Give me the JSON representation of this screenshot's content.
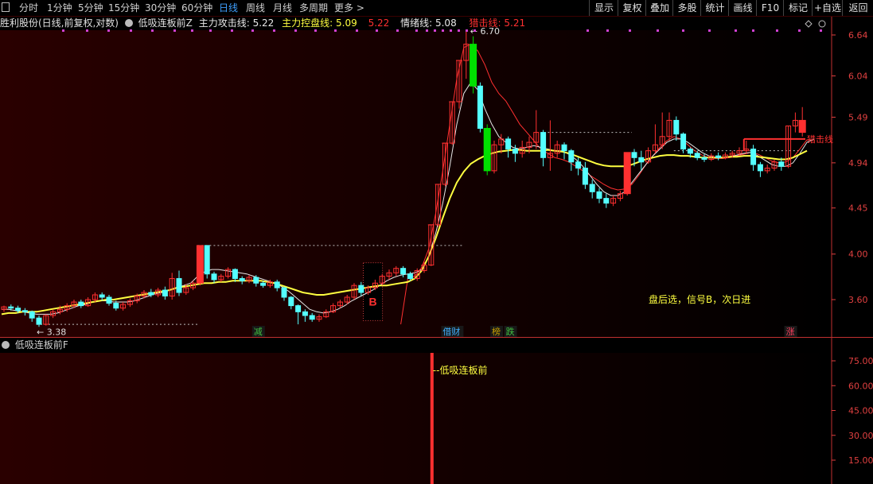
{
  "toolbar": {
    "periods": [
      "分时",
      "1分钟",
      "5分钟",
      "15分钟",
      "30分钟",
      "60分钟",
      "日线",
      "周线",
      "月线",
      "多周期",
      "更多 >"
    ],
    "active_period": "日线",
    "buttons": [
      "显示",
      "复权",
      "叠加",
      "多股",
      "统计",
      "画线",
      "F10",
      "标记",
      "+自选",
      "返回"
    ]
  },
  "info": {
    "stock": "胜利股份(日线,前复权,对数)",
    "indicator": "低吸连板前Z",
    "attack_label": "主力攻击线:",
    "attack_value": "5.22",
    "control_label": "主力控盘线:",
    "control_value": "5.09",
    "extra_value": "5.22",
    "emotion_label": "情绪线:",
    "emotion_value": "5.08",
    "strike_label": "猎击线:",
    "strike_value": "5.21"
  },
  "sub_panel": {
    "title": "低吸连板前F",
    "signal_label": "--低吸连板前"
  },
  "colors": {
    "up": "#ff3030",
    "down": "#54ffff",
    "ma_yellow": "#ffff40",
    "ma_white": "#e8e8e8",
    "ma_red": "#ff3030",
    "signal_green": "#00e000",
    "axis": "#e04040"
  },
  "chart_data": [
    {
      "type": "candlestick",
      "title": "",
      "scale": "log",
      "y_ticks": [
        3.6,
        4.0,
        4.45,
        4.94,
        5.49,
        6.04,
        6.64
      ],
      "high_label": "6.70",
      "low_label": "3.38",
      "annotation": "盘后选，信号B，次日进",
      "signal_letter": "B",
      "event_tags": [
        "减",
        "借财",
        "榜",
        "跌",
        "涨"
      ],
      "strike_marker": "猎击线",
      "series": [
        {
          "name": "主力攻击线",
          "color": "#e8e8e8"
        },
        {
          "name": "主力控盘线",
          "color": "#ffff40"
        },
        {
          "name": "猎击线",
          "color": "#ff3030"
        }
      ],
      "candles": [
        [
          3.52,
          3.54,
          3.5,
          3.55
        ],
        [
          3.54,
          3.53,
          3.51,
          3.56
        ],
        [
          3.53,
          3.51,
          3.49,
          3.55
        ],
        [
          3.51,
          3.5,
          3.47,
          3.53
        ],
        [
          3.5,
          3.45,
          3.42,
          3.51
        ],
        [
          3.45,
          3.4,
          3.38,
          3.47
        ],
        [
          3.4,
          3.47,
          3.39,
          3.48
        ],
        [
          3.47,
          3.5,
          3.45,
          3.52
        ],
        [
          3.5,
          3.52,
          3.48,
          3.55
        ],
        [
          3.52,
          3.55,
          3.5,
          3.57
        ],
        [
          3.55,
          3.58,
          3.53,
          3.6
        ],
        [
          3.58,
          3.55,
          3.53,
          3.6
        ],
        [
          3.55,
          3.6,
          3.54,
          3.62
        ],
        [
          3.6,
          3.64,
          3.58,
          3.66
        ],
        [
          3.64,
          3.62,
          3.59,
          3.66
        ],
        [
          3.62,
          3.57,
          3.55,
          3.64
        ],
        [
          3.57,
          3.53,
          3.51,
          3.59
        ],
        [
          3.53,
          3.56,
          3.51,
          3.58
        ],
        [
          3.56,
          3.59,
          3.54,
          3.61
        ],
        [
          3.59,
          3.63,
          3.57,
          3.65
        ],
        [
          3.63,
          3.66,
          3.61,
          3.68
        ],
        [
          3.66,
          3.64,
          3.62,
          3.69
        ],
        [
          3.64,
          3.68,
          3.62,
          3.7
        ],
        [
          3.68,
          3.63,
          3.6,
          3.71
        ],
        [
          3.63,
          3.78,
          3.6,
          3.83
        ],
        [
          3.78,
          3.66,
          3.63,
          3.85
        ],
        [
          3.66,
          3.7,
          3.64,
          3.73
        ],
        [
          3.7,
          3.74,
          3.68,
          3.76
        ],
        [
          3.74,
          4.08,
          3.72,
          4.08
        ],
        [
          4.08,
          3.82,
          3.78,
          4.08
        ],
        [
          3.82,
          3.77,
          3.74,
          3.84
        ],
        [
          3.77,
          3.8,
          3.75,
          3.82
        ],
        [
          3.8,
          3.86,
          3.78,
          3.88
        ],
        [
          3.86,
          3.78,
          3.75,
          3.87
        ],
        [
          3.78,
          3.76,
          3.73,
          3.8
        ],
        [
          3.76,
          3.79,
          3.74,
          3.81
        ],
        [
          3.79,
          3.74,
          3.71,
          3.81
        ],
        [
          3.74,
          3.72,
          3.7,
          3.76
        ],
        [
          3.72,
          3.75,
          3.7,
          3.77
        ],
        [
          3.75,
          3.7,
          3.67,
          3.77
        ],
        [
          3.7,
          3.62,
          3.59,
          3.71
        ],
        [
          3.62,
          3.55,
          3.52,
          3.63
        ],
        [
          3.55,
          3.5,
          3.4,
          3.56
        ],
        [
          3.5,
          3.47,
          3.42,
          3.52
        ],
        [
          3.47,
          3.44,
          3.42,
          3.49
        ],
        [
          3.44,
          3.46,
          3.42,
          3.48
        ],
        [
          3.46,
          3.5,
          3.45,
          3.52
        ],
        [
          3.5,
          3.55,
          3.49,
          3.57
        ],
        [
          3.55,
          3.58,
          3.53,
          3.6
        ],
        [
          3.58,
          3.62,
          3.56,
          3.64
        ],
        [
          3.62,
          3.72,
          3.6,
          3.74
        ],
        [
          3.72,
          3.66,
          3.63,
          3.75
        ],
        [
          3.66,
          3.7,
          3.64,
          3.72
        ],
        [
          3.7,
          3.74,
          3.68,
          3.77
        ],
        [
          3.74,
          3.8,
          3.72,
          3.82
        ],
        [
          3.8,
          3.83,
          3.77,
          3.86
        ],
        [
          3.83,
          3.87,
          3.8,
          3.89
        ],
        [
          3.87,
          3.82,
          3.79,
          3.89
        ],
        [
          3.82,
          3.78,
          3.76,
          3.84
        ],
        [
          3.78,
          3.85,
          3.76,
          3.87
        ],
        [
          3.85,
          3.9,
          3.83,
          3.93
        ],
        [
          3.9,
          4.28,
          3.89,
          4.28
        ],
        [
          4.28,
          4.7,
          4.26,
          4.7
        ],
        [
          4.7,
          5.17,
          4.68,
          5.17
        ],
        [
          5.17,
          5.69,
          5.15,
          5.69
        ],
        [
          5.69,
          6.26,
          5.6,
          6.26
        ],
        [
          6.26,
          6.5,
          6.0,
          6.7
        ],
        [
          6.5,
          5.9,
          5.8,
          6.62
        ],
        [
          5.9,
          5.35,
          5.3,
          5.95
        ],
        [
          5.35,
          4.85,
          4.8,
          5.4
        ],
        [
          4.85,
          5.15,
          4.82,
          5.2
        ],
        [
          5.15,
          5.22,
          5.05,
          5.28
        ],
        [
          5.22,
          5.1,
          5.0,
          5.25
        ],
        [
          5.1,
          5.05,
          4.95,
          5.15
        ],
        [
          5.05,
          5.12,
          5.0,
          5.2
        ],
        [
          5.12,
          5.18,
          5.05,
          5.25
        ],
        [
          5.18,
          5.3,
          5.1,
          5.58
        ],
        [
          5.3,
          5.0,
          4.9,
          5.33
        ],
        [
          5.0,
          5.05,
          4.85,
          5.45
        ],
        [
          5.05,
          5.15,
          5.0,
          5.2
        ],
        [
          5.15,
          5.08,
          4.98,
          5.18
        ],
        [
          5.08,
          4.95,
          4.85,
          5.1
        ],
        [
          4.95,
          4.88,
          4.8,
          5.0
        ],
        [
          4.88,
          4.7,
          4.65,
          4.95
        ],
        [
          4.7,
          4.62,
          4.55,
          4.75
        ],
        [
          4.62,
          4.55,
          4.5,
          4.66
        ],
        [
          4.55,
          4.5,
          4.45,
          4.6
        ],
        [
          4.5,
          4.55,
          4.47,
          4.58
        ],
        [
          4.55,
          4.6,
          4.52,
          4.63
        ],
        [
          4.6,
          5.06,
          4.58,
          5.06
        ],
        [
          5.06,
          5.0,
          4.9,
          5.1
        ],
        [
          5.0,
          4.95,
          4.85,
          5.08
        ],
        [
          4.95,
          5.08,
          4.93,
          5.12
        ],
        [
          5.08,
          5.15,
          5.05,
          5.4
        ],
        [
          5.15,
          5.25,
          5.1,
          5.55
        ],
        [
          5.25,
          5.45,
          5.2,
          5.55
        ],
        [
          5.45,
          5.28,
          5.2,
          5.5
        ],
        [
          5.28,
          5.1,
          5.05,
          5.3
        ],
        [
          5.1,
          5.05,
          5.0,
          5.12
        ],
        [
          5.05,
          5.0,
          4.97,
          5.08
        ],
        [
          5.0,
          4.98,
          4.95,
          5.04
        ],
        [
          4.98,
          5.02,
          4.96,
          5.05
        ],
        [
          5.02,
          5.0,
          4.97,
          5.06
        ],
        [
          5.0,
          5.03,
          4.98,
          5.06
        ],
        [
          5.03,
          5.05,
          5.0,
          5.08
        ],
        [
          5.05,
          5.08,
          5.02,
          5.12
        ],
        [
          5.08,
          5.1,
          5.05,
          5.2
        ],
        [
          5.1,
          4.92,
          4.85,
          5.15
        ],
        [
          4.92,
          4.85,
          4.78,
          4.95
        ],
        [
          4.85,
          4.88,
          4.82,
          4.92
        ],
        [
          4.88,
          4.95,
          4.85,
          4.98
        ],
        [
          4.95,
          4.9,
          4.85,
          5.0
        ],
        [
          4.9,
          5.38,
          4.88,
          5.38
        ],
        [
          5.38,
          5.45,
          5.3,
          5.55
        ],
        [
          5.45,
          5.3,
          5.25,
          5.62
        ]
      ],
      "ma_yellow": [
        3.48,
        3.49,
        3.49,
        3.5,
        3.5,
        3.5,
        3.51,
        3.52,
        3.53,
        3.54,
        3.55,
        3.56,
        3.57,
        3.58,
        3.59,
        3.6,
        3.6,
        3.61,
        3.62,
        3.63,
        3.64,
        3.65,
        3.66,
        3.67,
        3.68,
        3.7,
        3.71,
        3.72,
        3.73,
        3.74,
        3.74,
        3.75,
        3.75,
        3.76,
        3.76,
        3.76,
        3.76,
        3.76,
        3.75,
        3.74,
        3.72,
        3.7,
        3.68,
        3.66,
        3.65,
        3.64,
        3.64,
        3.65,
        3.66,
        3.67,
        3.68,
        3.69,
        3.7,
        3.71,
        3.72,
        3.72,
        3.73,
        3.74,
        3.75,
        3.78,
        3.85,
        3.98,
        4.15,
        4.35,
        4.55,
        4.72,
        4.84,
        4.93,
        4.98,
        5.02,
        5.05,
        5.07,
        5.08,
        5.09,
        5.09,
        5.08,
        5.08,
        5.08,
        5.09,
        5.08,
        5.07,
        5.05,
        5.02,
        4.99,
        4.96,
        4.93,
        4.91,
        4.9,
        4.9,
        4.9,
        4.92,
        4.95,
        4.98,
        5.0,
        5.02,
        5.03,
        5.03,
        5.02,
        5.02,
        5.01,
        5.0,
        5.0,
        5.0,
        5.0,
        5.01,
        5.01,
        5.02,
        5.02,
        5.01,
        5.0,
        4.99,
        4.98,
        4.98,
        5.0,
        5.04,
        5.08
      ],
      "ma_white": [
        3.52,
        3.52,
        3.51,
        3.5,
        3.49,
        3.48,
        3.48,
        3.48,
        3.49,
        3.51,
        3.53,
        3.55,
        3.56,
        3.58,
        3.59,
        3.59,
        3.58,
        3.58,
        3.58,
        3.59,
        3.61,
        3.63,
        3.65,
        3.66,
        3.68,
        3.7,
        3.72,
        3.74,
        3.8,
        3.84,
        3.86,
        3.86,
        3.85,
        3.84,
        3.83,
        3.82,
        3.8,
        3.78,
        3.76,
        3.74,
        3.71,
        3.67,
        3.62,
        3.57,
        3.52,
        3.5,
        3.49,
        3.5,
        3.52,
        3.55,
        3.59,
        3.62,
        3.65,
        3.68,
        3.72,
        3.76,
        3.79,
        3.81,
        3.82,
        3.83,
        3.86,
        3.98,
        4.2,
        4.5,
        4.9,
        5.4,
        5.8,
        5.95,
        5.85,
        5.6,
        5.4,
        5.25,
        5.18,
        5.12,
        5.1,
        5.12,
        5.14,
        5.12,
        5.1,
        5.08,
        5.08,
        5.04,
        4.98,
        4.9,
        4.8,
        4.7,
        4.62,
        4.58,
        4.58,
        4.62,
        4.72,
        4.82,
        4.92,
        5.02,
        5.1,
        5.18,
        5.22,
        5.22,
        5.18,
        5.12,
        5.06,
        5.02,
        5.0,
        5.0,
        5.01,
        5.03,
        5.05,
        5.06,
        5.02,
        4.97,
        4.92,
        4.9,
        4.9,
        4.94,
        5.05,
        5.18,
        5.22
      ],
      "ma_red": [
        3.4,
        3.4,
        3.4,
        3.4,
        3.4,
        3.4,
        3.4,
        3.4,
        3.4,
        3.4,
        3.4,
        3.4,
        3.4,
        3.4,
        3.4,
        3.4,
        3.4,
        3.4,
        3.4,
        3.4,
        3.4,
        3.4,
        3.4,
        3.4,
        3.4,
        3.4,
        3.4,
        3.4,
        3.4,
        3.4,
        3.4,
        3.4,
        3.4,
        3.4,
        3.4,
        3.4,
        3.4,
        3.4,
        3.4,
        3.4,
        3.4,
        3.4,
        3.4,
        3.4,
        3.4,
        3.4,
        3.4,
        3.4,
        3.4,
        3.4,
        3.4,
        3.4,
        3.4,
        3.4,
        3.4,
        3.4,
        3.4,
        3.4,
        3.78,
        3.8,
        3.88,
        4.05,
        4.4,
        4.85,
        5.4,
        6.0,
        6.45,
        6.5,
        6.4,
        6.2,
        5.95,
        5.8,
        5.7,
        5.55,
        5.4,
        5.3,
        5.2,
        5.1,
        5.05,
        5.0,
        4.98,
        4.95,
        4.9,
        4.85,
        4.8,
        4.75,
        4.7,
        4.66,
        4.64,
        4.65,
        4.7,
        4.8,
        4.92,
        5.02,
        5.12,
        5.2,
        5.25,
        5.22,
        5.15,
        5.08,
        5.03,
        5.0,
        4.99,
        4.99,
        5.0,
        5.02,
        5.04,
        5.06,
        5.04,
        5.0,
        4.96,
        4.94,
        4.95,
        5.0,
        5.1,
        5.21,
        5.21
      ]
    },
    {
      "type": "bar",
      "title": "低吸连板前F",
      "y_ticks": [
        15.0,
        30.0,
        45.0,
        60.0,
        75.0
      ],
      "signal_index": 61,
      "signal_value": 100
    }
  ]
}
